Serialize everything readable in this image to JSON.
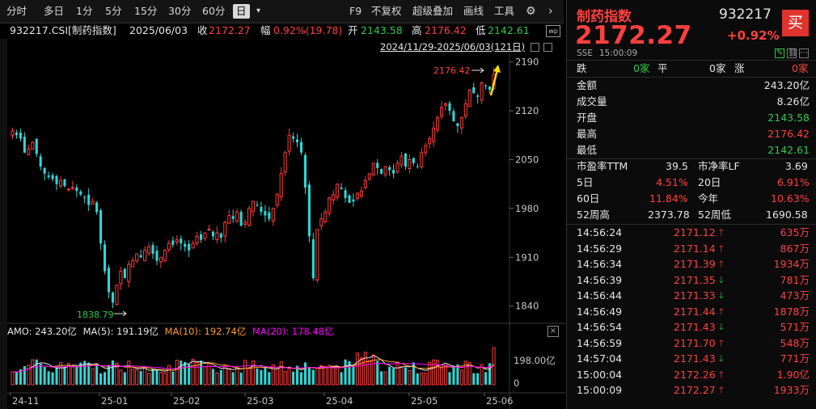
{
  "toolbar": {
    "periods": [
      "分时",
      "多日",
      "1分",
      "5分",
      "15分",
      "30分",
      "60分",
      "日"
    ],
    "selected_period": "日",
    "f9": "F9",
    "adjust": "不复权",
    "overlay": "超级叠加",
    "draw": "画线",
    "tools": "工具"
  },
  "info": {
    "code_name": "932217.CSI[制药指数]",
    "date": "2025/06/03",
    "close_label": "收",
    "close": "2172.27",
    "change_label": "幅",
    "change": "0.92%(19.78)",
    "open_label": "开",
    "open": "2143.58",
    "high_label": "高",
    "high": "2176.42",
    "low_label": "低",
    "low": "2142.61"
  },
  "range_label": "2024/11/29-2025/06/03(121日)",
  "main_chart": {
    "y_ticks": [
      "2190",
      "2120",
      "2050",
      "1980",
      "1910",
      "1840"
    ],
    "max_label": "2176.42",
    "min_label": "1838.79"
  },
  "volume_chart": {
    "amo": "AMO: 243.20亿",
    "ma5": "MA(5): 191.19亿",
    "ma10": "MA(10): 192.74亿",
    "ma20": "MA(20): 178.48亿",
    "y_ticks": [
      "198.00亿",
      "0"
    ]
  },
  "x_ticks": [
    "24-11",
    "25-01",
    "25-02",
    "25-03",
    "25-04",
    "25-05",
    "25-06"
  ],
  "quote": {
    "name": "制药指数",
    "code": "932217",
    "price": "2172.27",
    "change_pct": "+0.92%",
    "buy": "买",
    "exchange": "SSE",
    "time": "15:00:09",
    "fall_label": "跌",
    "fall_count": "0家",
    "flat_label": "平",
    "flat_count": "0家",
    "rise_label": "涨",
    "rise_count": "0家",
    "stats": [
      {
        "label": "金额",
        "value": "243.20亿",
        "color": "white"
      },
      {
        "label": "成交量",
        "value": "8.26亿",
        "color": "white"
      },
      {
        "label": "开盘",
        "value": "2143.58",
        "color": "green"
      },
      {
        "label": "最高",
        "value": "2176.42",
        "color": "red"
      },
      {
        "label": "最低",
        "value": "2142.61",
        "color": "green"
      }
    ],
    "pe_label": "市盈率TTM",
    "pe": "39.5",
    "pb_label": "市净率LF",
    "pb": "3.69",
    "d5_label": "5日",
    "d5": "4.51%",
    "d20_label": "20日",
    "d20": "6.91%",
    "d60_label": "60日",
    "d60": "11.84%",
    "ytd_label": "今年",
    "ytd": "10.63%",
    "w52h_label": "52周高",
    "w52h": "2373.78",
    "w52l_label": "52周低",
    "w52l": "1690.58"
  },
  "ticks": [
    {
      "time": "14:56:24",
      "price": "2171.12",
      "dir": "up",
      "vol": "635万"
    },
    {
      "time": "14:56:29",
      "price": "2171.14",
      "dir": "up",
      "vol": "867万"
    },
    {
      "time": "14:56:34",
      "price": "2171.39",
      "dir": "up",
      "vol": "1934万"
    },
    {
      "time": "14:56:39",
      "price": "2171.35",
      "dir": "down",
      "vol": "781万"
    },
    {
      "time": "14:56:44",
      "price": "2171.33",
      "dir": "down",
      "vol": "473万"
    },
    {
      "time": "14:56:49",
      "price": "2171.44",
      "dir": "up",
      "vol": "1878万"
    },
    {
      "time": "14:56:54",
      "price": "2171.43",
      "dir": "down",
      "vol": "571万"
    },
    {
      "time": "14:56:59",
      "price": "2171.70",
      "dir": "up",
      "vol": "548万"
    },
    {
      "time": "14:57:04",
      "price": "2171.43",
      "dir": "down",
      "vol": "771万"
    },
    {
      "time": "15:00:04",
      "price": "2172.26",
      "dir": "up",
      "vol": "1.90亿"
    },
    {
      "time": "15:00:09",
      "price": "2172.27",
      "dir": "up",
      "vol": "1933万"
    }
  ],
  "chart_data": {
    "type": "candlestick",
    "y_range": [
      1820,
      2200
    ],
    "y_ticks": [
      2190,
      2120,
      2050,
      1980,
      1910,
      1840
    ],
    "x_ticks": [
      "24-11",
      "25-01",
      "25-02",
      "25-03",
      "25-04",
      "25-05",
      "25-06"
    ],
    "closes": [
      2091,
      2085,
      2080,
      2060,
      2065,
      2075,
      2058,
      2040,
      2030,
      2025,
      2022,
      2015,
      2020,
      2012,
      2008,
      2010,
      2005,
      2000,
      1995,
      1985,
      1990,
      1975,
      1930,
      1890,
      1860,
      1845,
      1870,
      1890,
      1880,
      1900,
      1905,
      1915,
      1910,
      1920,
      1925,
      1915,
      1905,
      1910,
      1920,
      1930,
      1928,
      1935,
      1930,
      1925,
      1920,
      1930,
      1940,
      1935,
      1945,
      1950,
      1940,
      1945,
      1938,
      1960,
      1970,
      1965,
      1975,
      1955,
      1960,
      1980,
      1990,
      1985,
      1975,
      1970,
      1965,
      1980,
      2000,
      2030,
      2060,
      2085,
      2080,
      2075,
      2060,
      2010,
      1940,
      1880,
      1950,
      1965,
      1975,
      1995,
      2000,
      2015,
      2008,
      1995,
      1988,
      1990,
      2002,
      2005,
      2020,
      2030,
      2045,
      2038,
      2030,
      2040,
      2035,
      2030,
      2045,
      2055,
      2040,
      2050,
      2045,
      2040,
      2060,
      2070,
      2080,
      2095,
      2110,
      2125,
      2130,
      2120,
      2105,
      2098,
      2110,
      2130,
      2150,
      2145,
      2140,
      2160,
      2155,
      2150,
      2172.27
    ],
    "max": {
      "label": "2176.42"
    },
    "min": {
      "label": "1838.79"
    },
    "volume": {
      "amo": "243.20亿",
      "ma5": "191.19亿",
      "ma10": "192.74亿",
      "ma20": "178.48亿",
      "y_ticks": [
        "198.00亿",
        "0"
      ]
    }
  }
}
